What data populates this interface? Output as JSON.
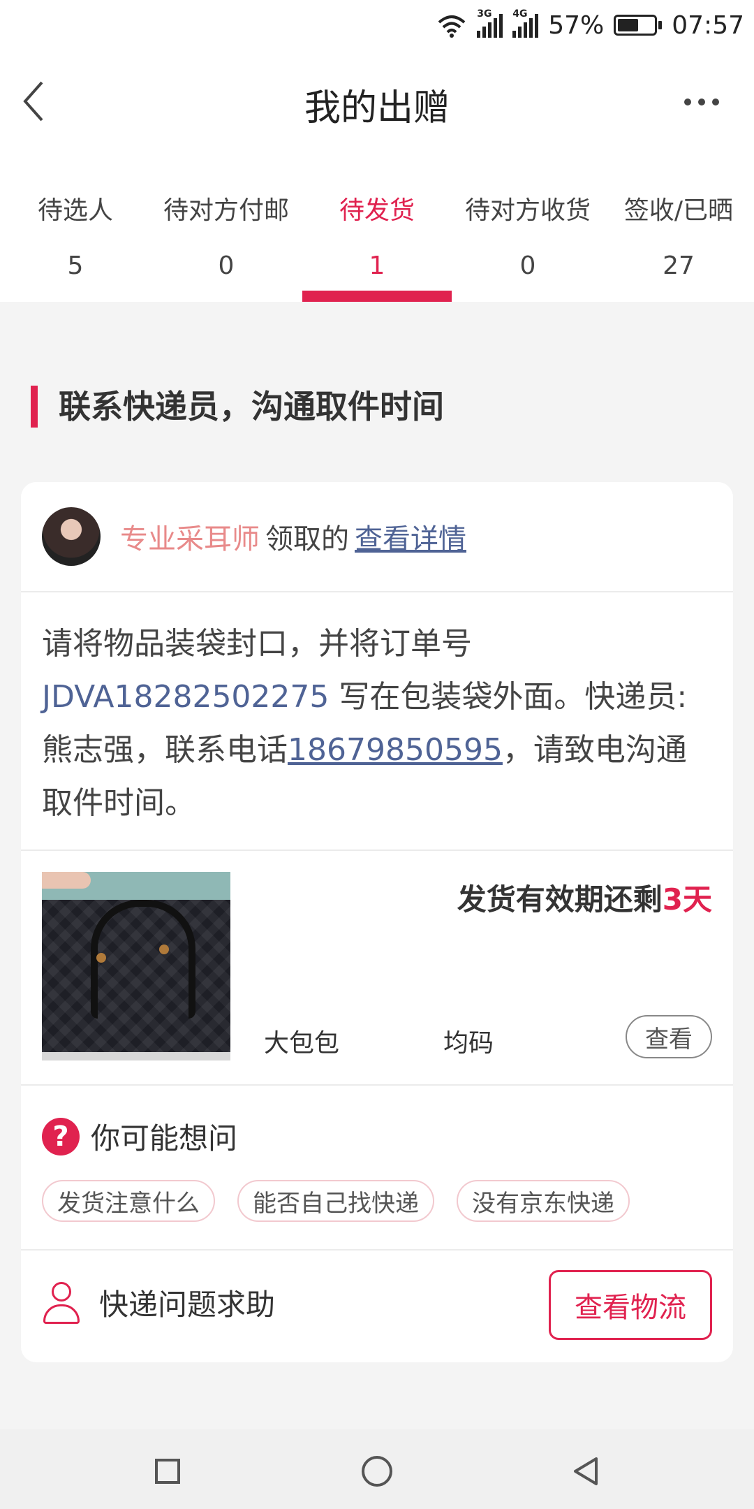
{
  "status_bar": {
    "net1": "3G",
    "net2": "4G",
    "battery_text": "57%",
    "battery_level": 0.57,
    "time": "07:57"
  },
  "header": {
    "title": "我的出赠"
  },
  "tabs": [
    {
      "label": "待选人",
      "count": "5"
    },
    {
      "label": "待对方付邮",
      "count": "0"
    },
    {
      "label": "待发货",
      "count": "1",
      "active": true
    },
    {
      "label": "待对方收货",
      "count": "0"
    },
    {
      "label": "签收/已晒",
      "count": "27"
    }
  ],
  "section_title": "联系快递员，沟通取件时间",
  "card": {
    "username": "专业采耳师",
    "claimed_text": "领取的",
    "detail_link": "查看详情",
    "instruction": {
      "part1": "请将物品装袋封口，并将订单号 ",
      "order_no": "JDVA18282502275",
      "part2": " 写在包装袋外面。快递员:熊志强，联系电话",
      "phone": "18679850595",
      "part3": "，请致电沟通取件时间。"
    },
    "product": {
      "deadline_prefix": "发货有效期还剩",
      "deadline_days": "3天",
      "name": "大包包",
      "size": "均码",
      "view_label": "查看"
    },
    "faq": {
      "title": "你可能想问",
      "chips": [
        "发货注意什么",
        "能否自己找快递",
        "没有京东快递"
      ]
    },
    "help": {
      "label": "快递问题求助",
      "logistics_button": "查看物流"
    }
  },
  "colors": {
    "accent": "#e0224f",
    "link": "#4f6395",
    "username": "#e88a8a"
  }
}
